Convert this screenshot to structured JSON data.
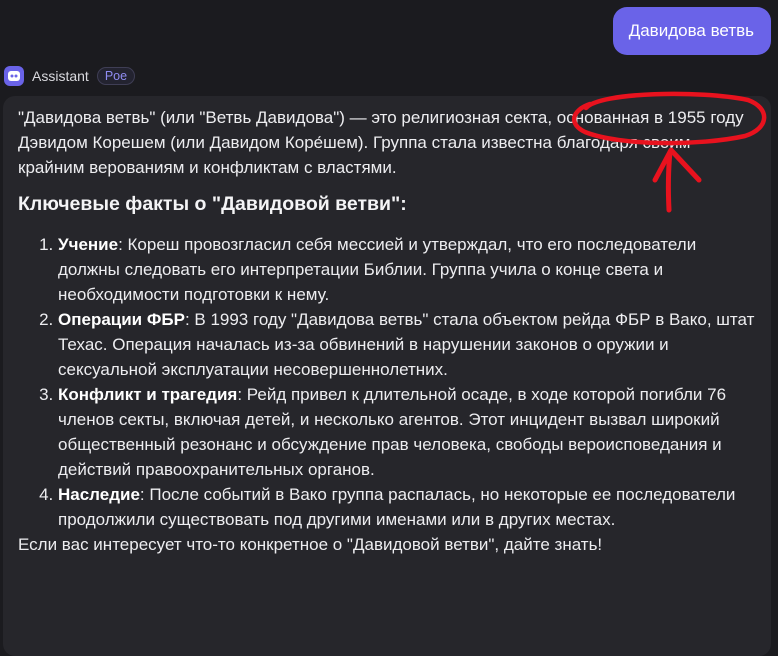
{
  "user_message": "Давидова ветвь",
  "assistant": {
    "name": "Assistant",
    "badge": "Poe"
  },
  "response": {
    "intro": "\"Давидова ветвь\" (или \"Ветвь Давидова\") — это религиозная секта, основанная в 1955 году Дэвидом Корешем (или Давидом Коре́шем). Группа стала известна благодаря своим крайним верованиям и конфликтам с властями.",
    "heading": "Ключевые факты о \"Давидовой ветви\":",
    "items": [
      {
        "title": "Учение",
        "text": ": Кореш провозгласил себя мессией и утверждал, что его последователи должны следовать его интерпретации Библии. Группа учила о конце света и необходимости подготовки к нему."
      },
      {
        "title": "Операции ФБР",
        "text": ": В 1993 году \"Давидова ветвь\" стала объектом рейда ФБР в Вако, штат Техас. Операция началась из-за обвинений в нарушении законов о оружии и сексуальной эксплуатации несовершеннолетних."
      },
      {
        "title": "Конфликт и трагедия",
        "text": ": Рейд привел к длительной осаде, в ходе которой погибли 76 членов секты, включая детей, и несколько агентов. Этот инцидент вызвал широкий общественный резонанс и обсуждение прав человека, свободы вероисповедания и действий правоохранительных органов."
      },
      {
        "title": "Наследие",
        "text": ": После событий в Вако группа распалась, но некоторые ее последователи продолжили существовать под другими именами или в других местах."
      }
    ],
    "outro": "Если вас интересует что-то конкретное о \"Давидовой ветви\", дайте знать!"
  },
  "colors": {
    "background": "#1b1b1f",
    "message_bg": "#26262b",
    "accent": "#6a63e8",
    "annotation": "#e8121e"
  }
}
